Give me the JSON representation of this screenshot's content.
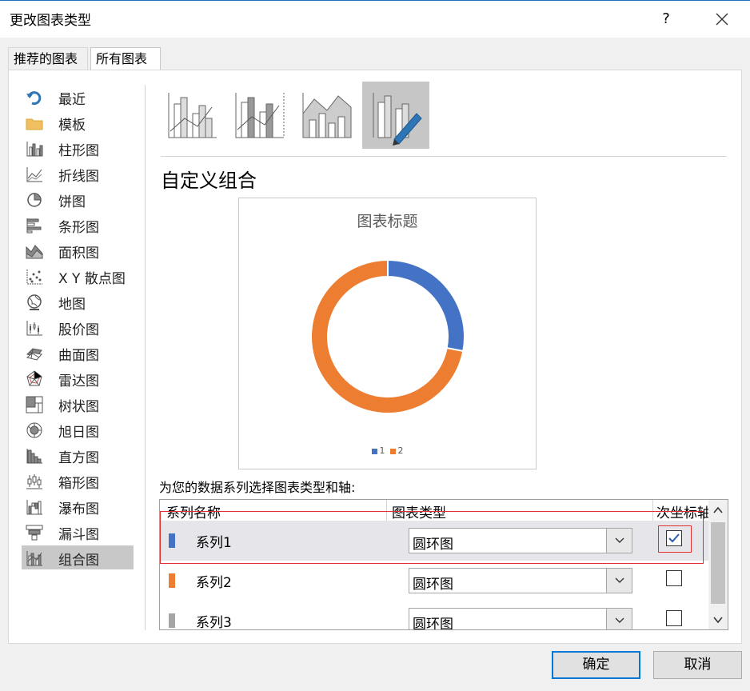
{
  "window": {
    "title": "更改图表类型",
    "help": "?"
  },
  "tabs": [
    {
      "label": "推荐的图表"
    },
    {
      "label": "所有图表"
    }
  ],
  "sidebar": {
    "items": [
      {
        "label": "最近",
        "icon": "recent-icon"
      },
      {
        "label": "模板",
        "icon": "folder-icon"
      },
      {
        "label": "柱形图",
        "icon": "column-chart-icon"
      },
      {
        "label": "折线图",
        "icon": "line-chart-icon"
      },
      {
        "label": "饼图",
        "icon": "pie-chart-icon"
      },
      {
        "label": "条形图",
        "icon": "bar-chart-icon"
      },
      {
        "label": "面积图",
        "icon": "area-chart-icon"
      },
      {
        "label": "X Y 散点图",
        "icon": "scatter-chart-icon"
      },
      {
        "label": "地图",
        "icon": "map-chart-icon"
      },
      {
        "label": "股价图",
        "icon": "stock-chart-icon"
      },
      {
        "label": "曲面图",
        "icon": "surface-chart-icon"
      },
      {
        "label": "雷达图",
        "icon": "radar-chart-icon"
      },
      {
        "label": "树状图",
        "icon": "treemap-chart-icon"
      },
      {
        "label": "旭日图",
        "icon": "sunburst-chart-icon"
      },
      {
        "label": "直方图",
        "icon": "histogram-chart-icon"
      },
      {
        "label": "箱形图",
        "icon": "box-whisker-chart-icon"
      },
      {
        "label": "瀑布图",
        "icon": "waterfall-chart-icon"
      },
      {
        "label": "漏斗图",
        "icon": "funnel-chart-icon"
      },
      {
        "label": "组合图",
        "icon": "combo-chart-icon"
      }
    ],
    "selected": "组合图"
  },
  "main": {
    "heading": "自定义组合",
    "series_prompt": "为您的数据系列选择图表类型和轴:",
    "columns": {
      "name": "系列名称",
      "type": "图表类型",
      "secondary": "次坐标轴"
    },
    "rows": [
      {
        "name": "系列1",
        "chart_type": "圆环图",
        "secondary": true,
        "color": "#4472c4"
      },
      {
        "name": "系列2",
        "chart_type": "圆环图",
        "secondary": false,
        "color": "#ed7d31"
      },
      {
        "name": "系列3",
        "chart_type": "圆环图",
        "secondary": false,
        "color": "#a5a5a5"
      }
    ]
  },
  "colors": {
    "series1": "#4472c4",
    "series2": "#ed7d31",
    "series3": "#a5a5a5",
    "accent": "#0078d7"
  },
  "chart_data": {
    "type": "pie",
    "variant": "doughnut",
    "title": "图表标题",
    "categories": [
      "1",
      "2"
    ],
    "values": [
      28,
      72
    ],
    "colors": [
      "#4472c4",
      "#ed7d31"
    ],
    "legend": "bottom"
  },
  "buttons": {
    "ok": "确定",
    "cancel": "取消"
  }
}
